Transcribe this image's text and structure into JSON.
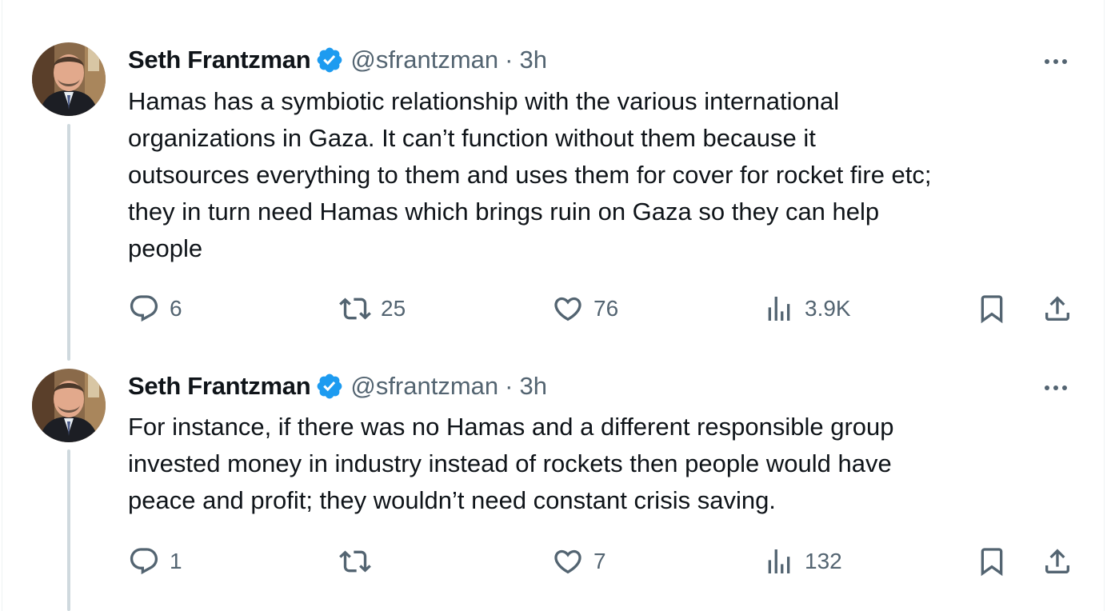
{
  "tweets": [
    {
      "display_name": "Seth Frantzman",
      "handle": "@sfrantzman",
      "separator": "·",
      "time": "3h",
      "text": "Hamas has a symbiotic relationship with the various international\norganizations in Gaza. It can’t function without them because it\noutsources everything to them and uses them for cover for rocket fire etc;\nthey in turn need Hamas which brings ruin on Gaza so they can help\npeople",
      "replies": "6",
      "reposts": "25",
      "likes": "76",
      "views": "3.9K"
    },
    {
      "display_name": "Seth Frantzman",
      "handle": "@sfrantzman",
      "separator": "·",
      "time": "3h",
      "text": "For instance, if there was no Hamas and a different responsible group\ninvested money in industry instead of rockets then people would have\npeace and profit; they wouldn’t need constant crisis saving.",
      "replies": "1",
      "reposts": "",
      "likes": "7",
      "views": "132"
    }
  ],
  "icons": {
    "reply": "reply-icon",
    "repost": "repost-icon",
    "like": "like-icon",
    "views": "views-icon",
    "bookmark": "bookmark-icon",
    "share": "share-icon",
    "more": "more-icon",
    "verified": "verified-badge-icon"
  },
  "colors": {
    "text_primary": "#0f1419",
    "text_secondary": "#536471",
    "verified_blue": "#1d9bf0",
    "thread_line": "#cfd9de"
  }
}
